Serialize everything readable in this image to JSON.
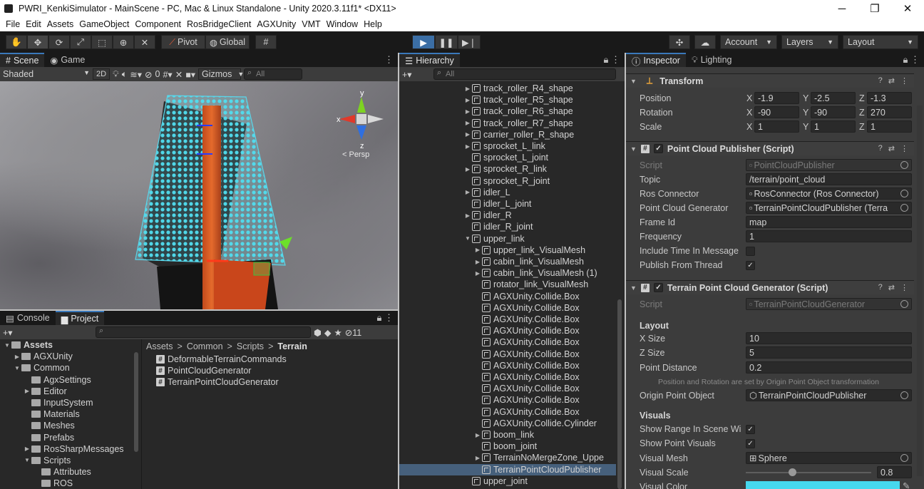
{
  "window": {
    "title": "PWRI_KenkiSimulator - MainScene - PC, Mac & Linux Standalone - Unity 2020.3.11f1* <DX11>",
    "minimize": "─",
    "maximize": "❐",
    "close": "✕"
  },
  "menu": [
    "File",
    "Edit",
    "Assets",
    "GameObject",
    "Component",
    "RosBridgeClient",
    "AGXUnity",
    "VMT",
    "Window",
    "Help"
  ],
  "toolbar": {
    "pivot": "Pivot",
    "global": "Global",
    "account": "Account",
    "layers": "Layers",
    "layout": "Layout",
    "accent_color": "#3b6ea5"
  },
  "scene": {
    "tab_scene": "Scene",
    "tab_game": "Game",
    "shading": "Shaded",
    "mode_2d": "2D",
    "hidden_count": "0",
    "gizmos": "Gizmos",
    "search_placeholder": "All",
    "persp": "< Persp",
    "axis_x": "x",
    "axis_y": "y",
    "axis_z": "z"
  },
  "project": {
    "tab_console": "Console",
    "tab_project": "Project",
    "hidden_count": "11",
    "tree": [
      {
        "label": "Assets",
        "depth": 0,
        "open": true,
        "bold": true
      },
      {
        "label": "AGXUnity",
        "depth": 1,
        "open": false
      },
      {
        "label": "Common",
        "depth": 1,
        "open": true
      },
      {
        "label": "AgxSettings",
        "depth": 2,
        "open": null
      },
      {
        "label": "Editor",
        "depth": 2,
        "open": false
      },
      {
        "label": "InputSystem",
        "depth": 2,
        "open": null
      },
      {
        "label": "Materials",
        "depth": 2,
        "open": null
      },
      {
        "label": "Meshes",
        "depth": 2,
        "open": null
      },
      {
        "label": "Prefabs",
        "depth": 2,
        "open": null
      },
      {
        "label": "RosSharpMessages",
        "depth": 2,
        "open": false
      },
      {
        "label": "Scripts",
        "depth": 2,
        "open": true
      },
      {
        "label": "Attributes",
        "depth": 3,
        "open": null
      },
      {
        "label": "ROS",
        "depth": 3,
        "open": null
      }
    ],
    "breadcrumb": [
      "Assets",
      "Common",
      "Scripts",
      "Terrain"
    ],
    "files": [
      "DeformableTerrainCommands",
      "PointCloudGenerator",
      "TerrainPointCloudGenerator"
    ]
  },
  "hierarchy": {
    "tab": "Hierarchy",
    "search_placeholder": "All",
    "items": [
      {
        "label": "track_roller_R4_shape",
        "depth": 0,
        "arrow": true
      },
      {
        "label": "track_roller_R5_shape",
        "depth": 0,
        "arrow": true
      },
      {
        "label": "track_roller_R6_shape",
        "depth": 0,
        "arrow": true
      },
      {
        "label": "track_roller_R7_shape",
        "depth": 0,
        "arrow": true
      },
      {
        "label": "carrier_roller_R_shape",
        "depth": 0,
        "arrow": true
      },
      {
        "label": "sprocket_L_link",
        "depth": 0,
        "arrow": true
      },
      {
        "label": "sprocket_L_joint",
        "depth": 0,
        "arrow": false
      },
      {
        "label": "sprocket_R_link",
        "depth": 0,
        "arrow": true
      },
      {
        "label": "sprocket_R_joint",
        "depth": 0,
        "arrow": false
      },
      {
        "label": "idler_L",
        "depth": 0,
        "arrow": true
      },
      {
        "label": "idler_L_joint",
        "depth": 0,
        "arrow": false
      },
      {
        "label": "idler_R",
        "depth": 0,
        "arrow": true
      },
      {
        "label": "idler_R_joint",
        "depth": 0,
        "arrow": false
      },
      {
        "label": "upper_link",
        "depth": 0,
        "arrow": true,
        "open": true
      },
      {
        "label": "upper_link_VisualMesh",
        "depth": 1,
        "arrow": true
      },
      {
        "label": "cabin_link_VisualMesh",
        "depth": 1,
        "arrow": true
      },
      {
        "label": "cabin_link_VisualMesh (1)",
        "depth": 1,
        "arrow": true
      },
      {
        "label": "rotator_link_VisualMesh",
        "depth": 1,
        "arrow": false
      },
      {
        "label": "AGXUnity.Collide.Box",
        "depth": 1,
        "arrow": false
      },
      {
        "label": "AGXUnity.Collide.Box",
        "depth": 1,
        "arrow": false
      },
      {
        "label": "AGXUnity.Collide.Box",
        "depth": 1,
        "arrow": false
      },
      {
        "label": "AGXUnity.Collide.Box",
        "depth": 1,
        "arrow": false
      },
      {
        "label": "AGXUnity.Collide.Box",
        "depth": 1,
        "arrow": false
      },
      {
        "label": "AGXUnity.Collide.Box",
        "depth": 1,
        "arrow": false
      },
      {
        "label": "AGXUnity.Collide.Box",
        "depth": 1,
        "arrow": false
      },
      {
        "label": "AGXUnity.Collide.Box",
        "depth": 1,
        "arrow": false
      },
      {
        "label": "AGXUnity.Collide.Box",
        "depth": 1,
        "arrow": false
      },
      {
        "label": "AGXUnity.Collide.Box",
        "depth": 1,
        "arrow": false
      },
      {
        "label": "AGXUnity.Collide.Box",
        "depth": 1,
        "arrow": false
      },
      {
        "label": "AGXUnity.Collide.Cylinder",
        "depth": 1,
        "arrow": false
      },
      {
        "label": "boom_link",
        "depth": 1,
        "arrow": true
      },
      {
        "label": "boom_joint",
        "depth": 1,
        "arrow": false
      },
      {
        "label": "TerrainNoMergeZone_Uppe",
        "depth": 1,
        "arrow": true
      },
      {
        "label": "TerrainPointCloudPublisher",
        "depth": 1,
        "arrow": false,
        "selected": true
      },
      {
        "label": "upper_joint",
        "depth": 0,
        "arrow": false
      }
    ]
  },
  "inspector": {
    "tab_inspector": "Inspector",
    "tab_lighting": "Lighting",
    "transform": {
      "title": "Transform",
      "position_label": "Position",
      "position": {
        "x": "-1.9",
        "y": "-2.5",
        "z": "-1.3"
      },
      "rotation_label": "Rotation",
      "rotation": {
        "x": "-90",
        "y": "-90",
        "z": "270"
      },
      "scale_label": "Scale",
      "scale": {
        "x": "1",
        "y": "1",
        "z": "1"
      }
    },
    "publisher": {
      "title": "Point Cloud Publisher (Script)",
      "script_label": "Script",
      "script": "PointCloudPublisher",
      "topic_label": "Topic",
      "topic": "/terrain/point_cloud",
      "ros_connector_label": "Ros Connector",
      "ros_connector": "RosConnector (Ros Connector)",
      "generator_label": "Point Cloud Generator",
      "generator": "TerrainPointCloudPublisher (Terra",
      "frame_id_label": "Frame Id",
      "frame_id": "map",
      "frequency_label": "Frequency",
      "frequency": "1",
      "include_time_label": "Include Time In Message",
      "include_time": false,
      "publish_thread_label": "Publish From Thread",
      "publish_thread": true
    },
    "generator": {
      "title": "Terrain Point Cloud Generator (Script)",
      "script_label": "Script",
      "script": "TerrainPointCloudGenerator",
      "layout_header": "Layout",
      "x_size_label": "X Size",
      "x_size": "10",
      "z_size_label": "Z Size",
      "z_size": "5",
      "point_distance_label": "Point Distance",
      "point_distance": "0.2",
      "note": "Position and Rotation are set by Origin Point Object transformation",
      "origin_label": "Origin Point Object",
      "origin": "TerrainPointCloudPublisher",
      "visuals_header": "Visuals",
      "show_range_label": "Show Range In Scene Wi",
      "show_range": true,
      "show_points_label": "Show Point Visuals",
      "show_points": true,
      "visual_mesh_label": "Visual Mesh",
      "visual_mesh": "Sphere",
      "visual_scale_label": "Visual Scale",
      "visual_scale": "0.8",
      "visual_scale_fraction": 0.37,
      "visual_color_label": "Visual Color",
      "visual_color": "#46d8ee"
    }
  }
}
